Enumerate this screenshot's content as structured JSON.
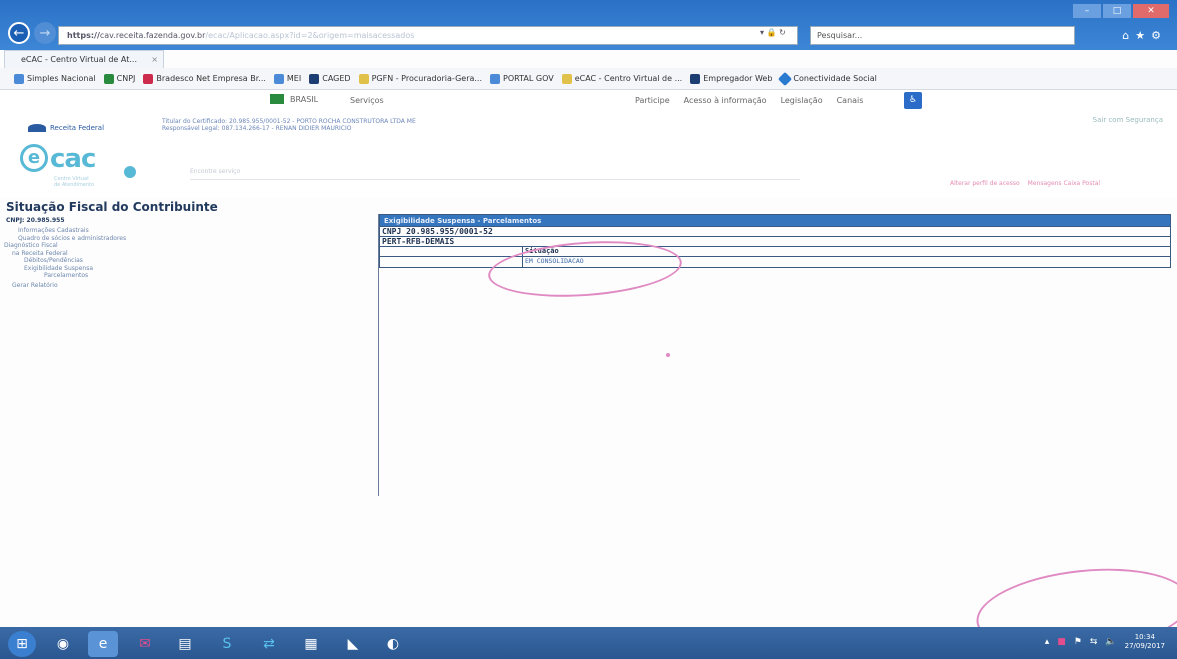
{
  "browser": {
    "url_prefix": "https://",
    "url_domain": "cav.receita.fazenda.gov.br",
    "url_path": "/ecac/Aplicacao.aspx?id=2&origem=maisacessados",
    "search_placeholder": "Pesquisar...",
    "tab_title": "eCAC - Centro Virtual de At...",
    "favorites": [
      "Simples Nacional",
      "CNPJ",
      "Bradesco Net Empresa Br...",
      "MEI",
      "CAGED",
      "PGFN - Procuradoria-Gera...",
      "PORTAL GOV",
      "eCAC - Centro Virtual de ...",
      "Empregador Web",
      "Conectividade Social"
    ]
  },
  "govbar": {
    "brasil": "BRASIL",
    "servicos": "Serviços",
    "links": [
      "Participe",
      "Acesso à informação",
      "Legislação",
      "Canais"
    ]
  },
  "header": {
    "logo_text": "Receita Federal",
    "cert_line1": "Titular do Certificado: 20.985.955/0001-52 - PORTO ROCHA CONSTRUTORA LTDA ME",
    "cert_line2": "Responsável Legal: 087.134.266-17 - RENAN DIDIER MAURICIO",
    "sair": "Sair com Segurança",
    "ecac_letter": "e",
    "ecac_word": "cac",
    "ecac_sub1": "Centro Virtual",
    "ecac_sub2": "de Atendimento",
    "search_placeholder": "Encontre serviço",
    "link1": "Alterar perfil de acesso",
    "link2": "Mensagens Caixa Postal"
  },
  "page": {
    "title": "Situação Fiscal do Contribuinte",
    "cnpj_label": "CNPJ: 20.985.955",
    "tree": [
      "Informações Cadastrais",
      "Quadro de sócios e administradores",
      "Diagnóstico Fiscal",
      "na Receita Federal",
      "Débitos/Pendências",
      "Exigibilidade Suspensa",
      "Parcelamentos",
      "Gerar Relatório"
    ]
  },
  "panel": {
    "header": "Exigibilidade Suspensa - Parcelamentos",
    "cnpj": "CNPJ 20.985.955/0001-52",
    "program": "PERT-RFB-DEMAIS",
    "col_header": "Situação",
    "status": "EM CONSOLIDACAO"
  },
  "taskbar": {
    "time": "10:34",
    "date": "27/09/2017"
  }
}
